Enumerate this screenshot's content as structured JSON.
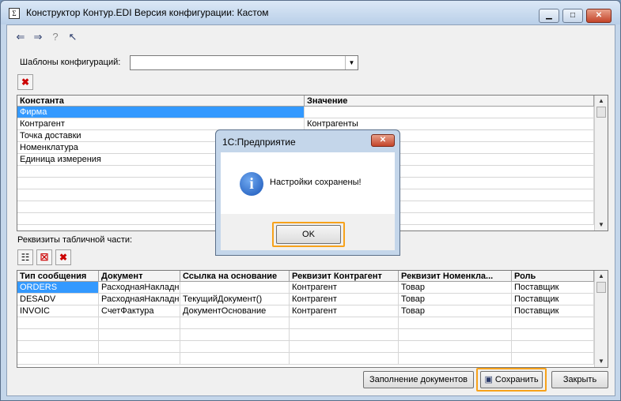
{
  "window": {
    "title": "Конструктор Контур.EDI      Версия конфигурации: Кастом",
    "minimize": "▁",
    "maximize": "□",
    "close": "✕"
  },
  "toolbar": {
    "icons": [
      "back-icon",
      "forward-icon",
      "help-icon",
      "pointer-help-icon"
    ]
  },
  "templates": {
    "label": "Шаблоны конфигураций:",
    "value": ""
  },
  "constants_grid": {
    "headers": [
      "Константа",
      "Значение"
    ],
    "rows": [
      {
        "name": "Фирма",
        "value": ""
      },
      {
        "name": "Контрагент",
        "value": "Контрагенты"
      },
      {
        "name": "Точка доставки",
        "value": ""
      },
      {
        "name": "Номенклатура",
        "value": ""
      },
      {
        "name": "Единица измерения",
        "value": ""
      }
    ]
  },
  "tabular": {
    "label": "Реквизиты табличной части:",
    "headers": [
      "Тип сообщения",
      "Документ",
      "Ссылка на основание",
      "Реквизит Контрагент",
      "Реквизит Номенкла...",
      "Роль"
    ],
    "rows": [
      [
        "ORDERS",
        "РасходнаяНакладн",
        "",
        "Контрагент",
        "Товар",
        "Поставщик"
      ],
      [
        "DESADV",
        "РасходнаяНакладн",
        "ТекущийДокумент()",
        "Контрагент",
        "Товар",
        "Поставщик"
      ],
      [
        "INVOIC",
        "СчетФактура",
        "ДокументОснование",
        "Контрагент",
        "Товар",
        "Поставщик"
      ]
    ]
  },
  "buttons": {
    "fill_docs": "Заполнение документов",
    "save": "Сохранить",
    "close": "Закрыть"
  },
  "dialog": {
    "title": "1С:Предприятие",
    "message": "Настройки сохранены!",
    "ok": "OK",
    "close": "✕"
  },
  "colors": {
    "selection": "#3399ff",
    "highlight": "#f7a21b"
  }
}
